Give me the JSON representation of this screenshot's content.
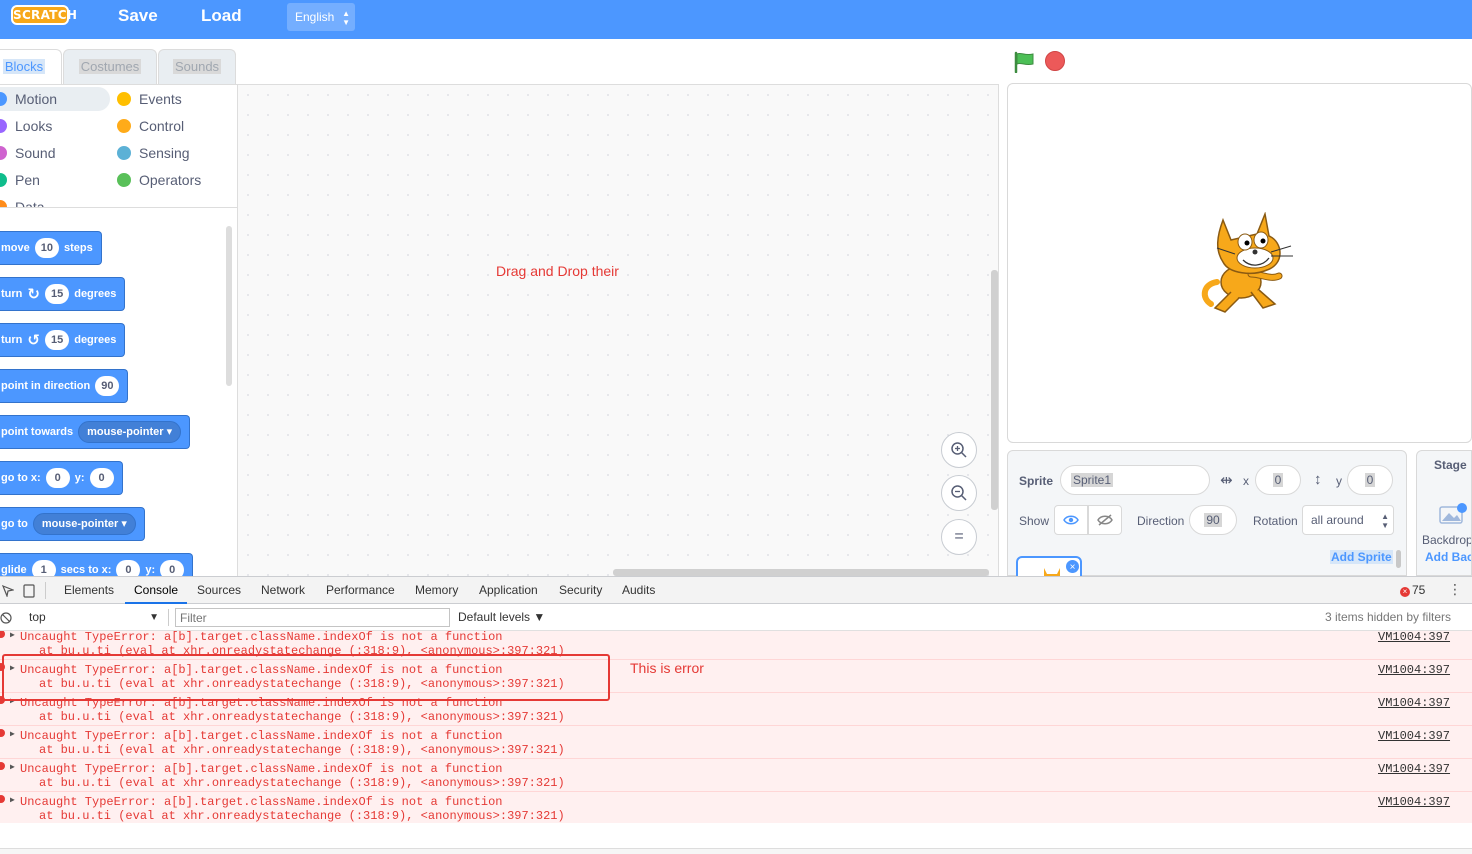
{
  "menubar": {
    "logo_text": "SCRATCH",
    "save_label": "Save",
    "load_label": "Load",
    "language": "English"
  },
  "tabs": [
    {
      "label": "Blocks",
      "active": true
    },
    {
      "label": "Costumes",
      "active": false
    },
    {
      "label": "Sounds",
      "active": false
    }
  ],
  "categories": [
    {
      "label": "Motion",
      "color": "#4c97ff",
      "selected": true
    },
    {
      "label": "Looks",
      "color": "#9966ff"
    },
    {
      "label": "Sound",
      "color": "#cf63cf"
    },
    {
      "label": "Pen",
      "color": "#0fbd8c"
    },
    {
      "label": "Data",
      "color": "#ff8c1a"
    },
    {
      "label": "Events",
      "color": "#ffbf00"
    },
    {
      "label": "Control",
      "color": "#ffab19"
    },
    {
      "label": "Sensing",
      "color": "#5cb1d6"
    },
    {
      "label": "Operators",
      "color": "#59c059"
    }
  ],
  "blocks": {
    "move": {
      "label": "move",
      "value": "10",
      "suffix": "steps"
    },
    "turn_right": {
      "label": "turn",
      "value": "15",
      "suffix": "degrees"
    },
    "turn_left": {
      "label": "turn",
      "value": "15",
      "suffix": "degrees"
    },
    "point_direction": {
      "label": "point in direction",
      "value": "90"
    },
    "point_towards": {
      "label": "point towards",
      "option": "mouse-pointer"
    },
    "go_to_xy": {
      "label": "go to x:",
      "x": "0",
      "y_label": "y:",
      "y": "0"
    },
    "go_to": {
      "label": "go to",
      "option": "mouse-pointer"
    },
    "glide": {
      "label": "glide",
      "value": "1",
      "mid": "secs to x:",
      "x": "0",
      "y_label": "y:",
      "y": "0"
    }
  },
  "script_area": {
    "hint": "Drag and Drop their",
    "zoom_in": "+",
    "zoom_out": "−",
    "zoom_reset": "="
  },
  "sprite_info": {
    "sprite_label": "Sprite",
    "sprite_name": "Sprite1",
    "x_label": "x",
    "x_value": "0",
    "y_label": "y",
    "y_value": "0",
    "show_label": "Show",
    "direction_label": "Direction",
    "direction_value": "90",
    "rotation_label": "Rotation",
    "rotation_value": "all around",
    "add_sprite": "Add Sprite"
  },
  "stage_panel": {
    "title": "Stage",
    "backdrop_label": "Backdrop",
    "add_backdrop": "Add Backdrop"
  },
  "devtools": {
    "tabs": [
      "Elements",
      "Console",
      "Sources",
      "Network",
      "Performance",
      "Memory",
      "Application",
      "Security",
      "Audits"
    ],
    "active_tab": "Console",
    "context": "top",
    "filter_placeholder": "Filter",
    "levels": "Default levels ▼",
    "hidden_note": "3 items hidden by filters",
    "error_count": "75",
    "errors": [
      {
        "line1": "Uncaught TypeError: a[b].target.className.indexOf is not a function",
        "line2": "at bu.u.ti (eval at xhr.onreadystatechange (:318:9), <anonymous>:397:321)",
        "source": "VM1004:397"
      },
      {
        "line1": "Uncaught TypeError: a[b].target.className.indexOf is not a function",
        "line2": "at bu.u.ti (eval at xhr.onreadystatechange (:318:9), <anonymous>:397:321)",
        "source": "VM1004:397"
      },
      {
        "line1": "Uncaught TypeError: a[b].target.className.indexOf is not a function",
        "line2": "at bu.u.ti (eval at xhr.onreadystatechange (:318:9), <anonymous>:397:321)",
        "source": "VM1004:397"
      },
      {
        "line1": "Uncaught TypeError: a[b].target.className.indexOf is not a function",
        "line2": "at bu.u.ti (eval at xhr.onreadystatechange (:318:9), <anonymous>:397:321)",
        "source": "VM1004:397"
      },
      {
        "line1": "Uncaught TypeError: a[b].target.className.indexOf is not a function",
        "line2": "at bu.u.ti (eval at xhr.onreadystatechange (:318:9), <anonymous>:397:321)",
        "source": "VM1004:397"
      },
      {
        "line1": "Uncaught TypeError: a[b].target.className.indexOf is not a function",
        "line2": "at bu.u.ti (eval at xhr.onreadystatechange (:318:9), <anonymous>:397:321)",
        "source": "VM1004:397"
      }
    ],
    "annotation": "This is error"
  }
}
